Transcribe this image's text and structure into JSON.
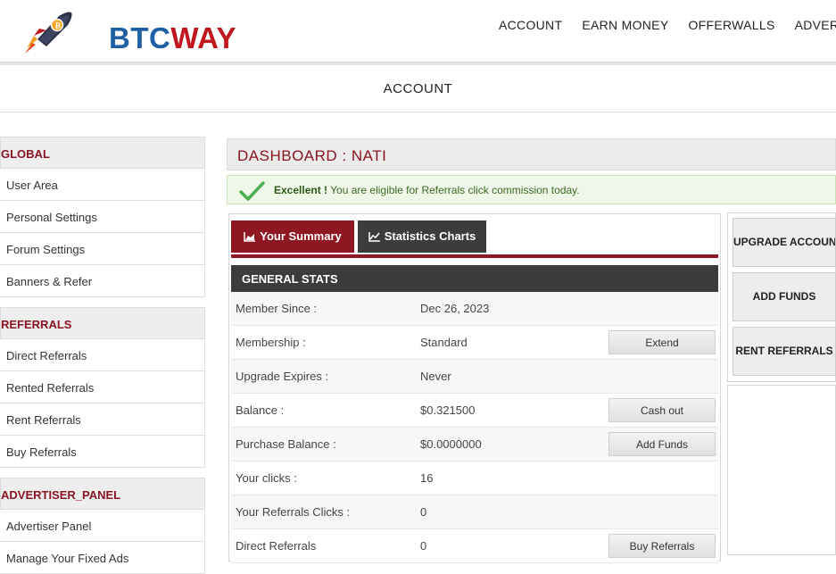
{
  "brand": {
    "part1": "BTC",
    "part2": "WAY"
  },
  "nav": [
    "ACCOUNT",
    "EARN MONEY",
    "OFFERWALLS",
    "ADVERTIS"
  ],
  "page_title": "ACCOUNT",
  "sidebar": {
    "global": {
      "title": "GLOBAL",
      "items": [
        "User Area",
        "Personal Settings",
        "Forum Settings",
        "Banners & Refer"
      ]
    },
    "referrals": {
      "title": "REFERRALS",
      "items": [
        "Direct Referrals",
        "Rented Referrals",
        "Rent Referrals",
        "Buy Referrals"
      ]
    },
    "advertiser": {
      "title": "ADVERTISER_PANEL",
      "items": [
        "Advertiser Panel",
        "Manage Your Fixed Ads"
      ]
    }
  },
  "dashboard": {
    "title": "DASHBOARD : NATI",
    "alert_strong": "Excellent !",
    "alert_text": "You are eligible for Referrals click commission today."
  },
  "tabs": {
    "summary": "Your Summary",
    "stats": "Statistics Charts"
  },
  "general_stats": {
    "heading": "GENERAL STATS",
    "rows": [
      {
        "label": "Member Since :",
        "value": "Dec 26, 2023",
        "button": ""
      },
      {
        "label": "Membership :",
        "value": "Standard",
        "button": "Extend"
      },
      {
        "label": "Upgrade Expires :",
        "value": "Never",
        "button": ""
      },
      {
        "label": "Balance :",
        "value": "$0.321500",
        "button": "Cash out"
      },
      {
        "label": "Purchase Balance :",
        "value": "$0.0000000",
        "button": "Add Funds"
      },
      {
        "label": "Your clicks :",
        "value": "16",
        "button": ""
      },
      {
        "label": "Your Referrals Clicks :",
        "value": "0",
        "button": ""
      },
      {
        "label": "Direct Referrals",
        "value": "0",
        "button": "Buy Referrals"
      }
    ]
  },
  "right_actions": [
    "UPGRADE ACCOUNT",
    "ADD FUNDS",
    "RENT REFERRALS"
  ],
  "colors": {
    "brand_blue": "#1f5fa6",
    "brand_red": "#c0161e",
    "accent": "#8e1722",
    "dark": "#3c3c3c",
    "success": "#4caf50"
  }
}
